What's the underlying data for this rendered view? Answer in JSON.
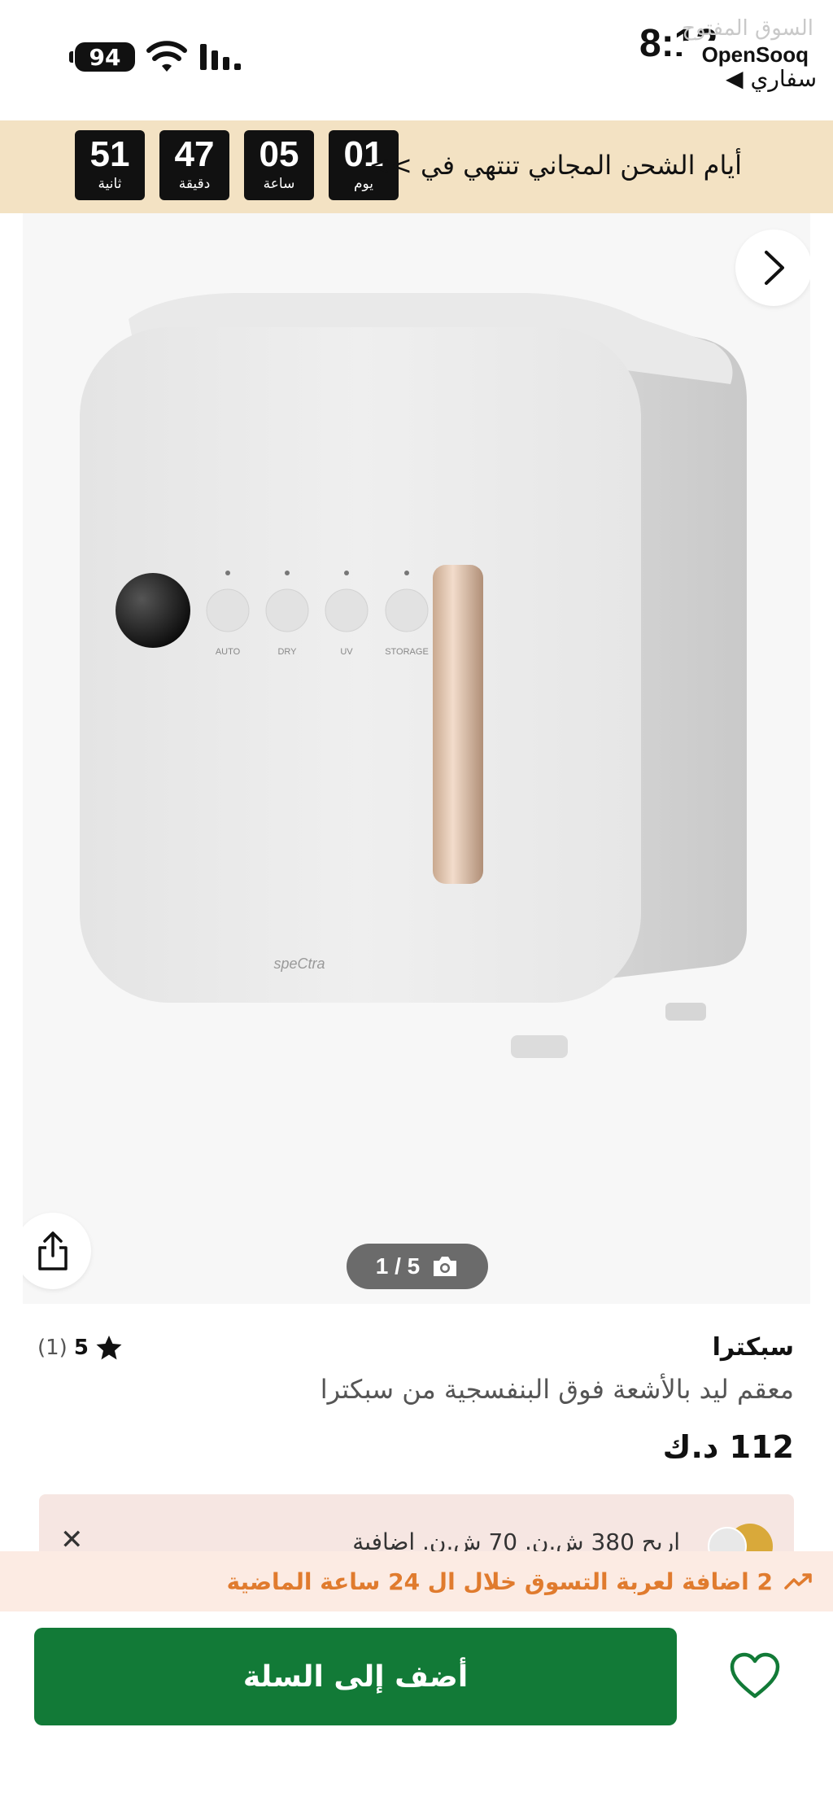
{
  "status_bar": {
    "battery": "94",
    "time": "8:12",
    "back_label": "◀ سفاري"
  },
  "watermark": {
    "arabic": "السوق المفتوح",
    "english": "OpenSooq"
  },
  "countdown": {
    "text": "أيام الشحن المجاني تنتهي في >>",
    "units": [
      {
        "value": "01",
        "label": "يوم"
      },
      {
        "value": "05",
        "label": "ساعة"
      },
      {
        "value": "47",
        "label": "دقيقة"
      },
      {
        "value": "51",
        "label": "ثانية"
      }
    ]
  },
  "gallery": {
    "counter": "1 / 5",
    "product_brand_mark": "speCtra",
    "panel_labels": [
      "AUTO",
      "DRY",
      "UV",
      "STORAGE"
    ]
  },
  "product": {
    "brand": "سبكترا",
    "title": "معقم ليد بالأشعة فوق البنفسجية من سبكترا",
    "price": "112 د.ك",
    "rating": "5",
    "reviews": "(1)"
  },
  "cashback": {
    "text": "اربح 380 ش.ن. 70 ش.ن. اضافية"
  },
  "social_proof": {
    "text": "2 اضافة لعربة التسوق خلال ال 24 ساعة الماضية"
  },
  "actions": {
    "add_to_cart": "أضف إلى السلة"
  },
  "colors": {
    "banner_bg": "#f3e2c3",
    "cart_button": "#127a37",
    "social_text": "#e07b2e",
    "social_bg": "#fcebe3"
  }
}
